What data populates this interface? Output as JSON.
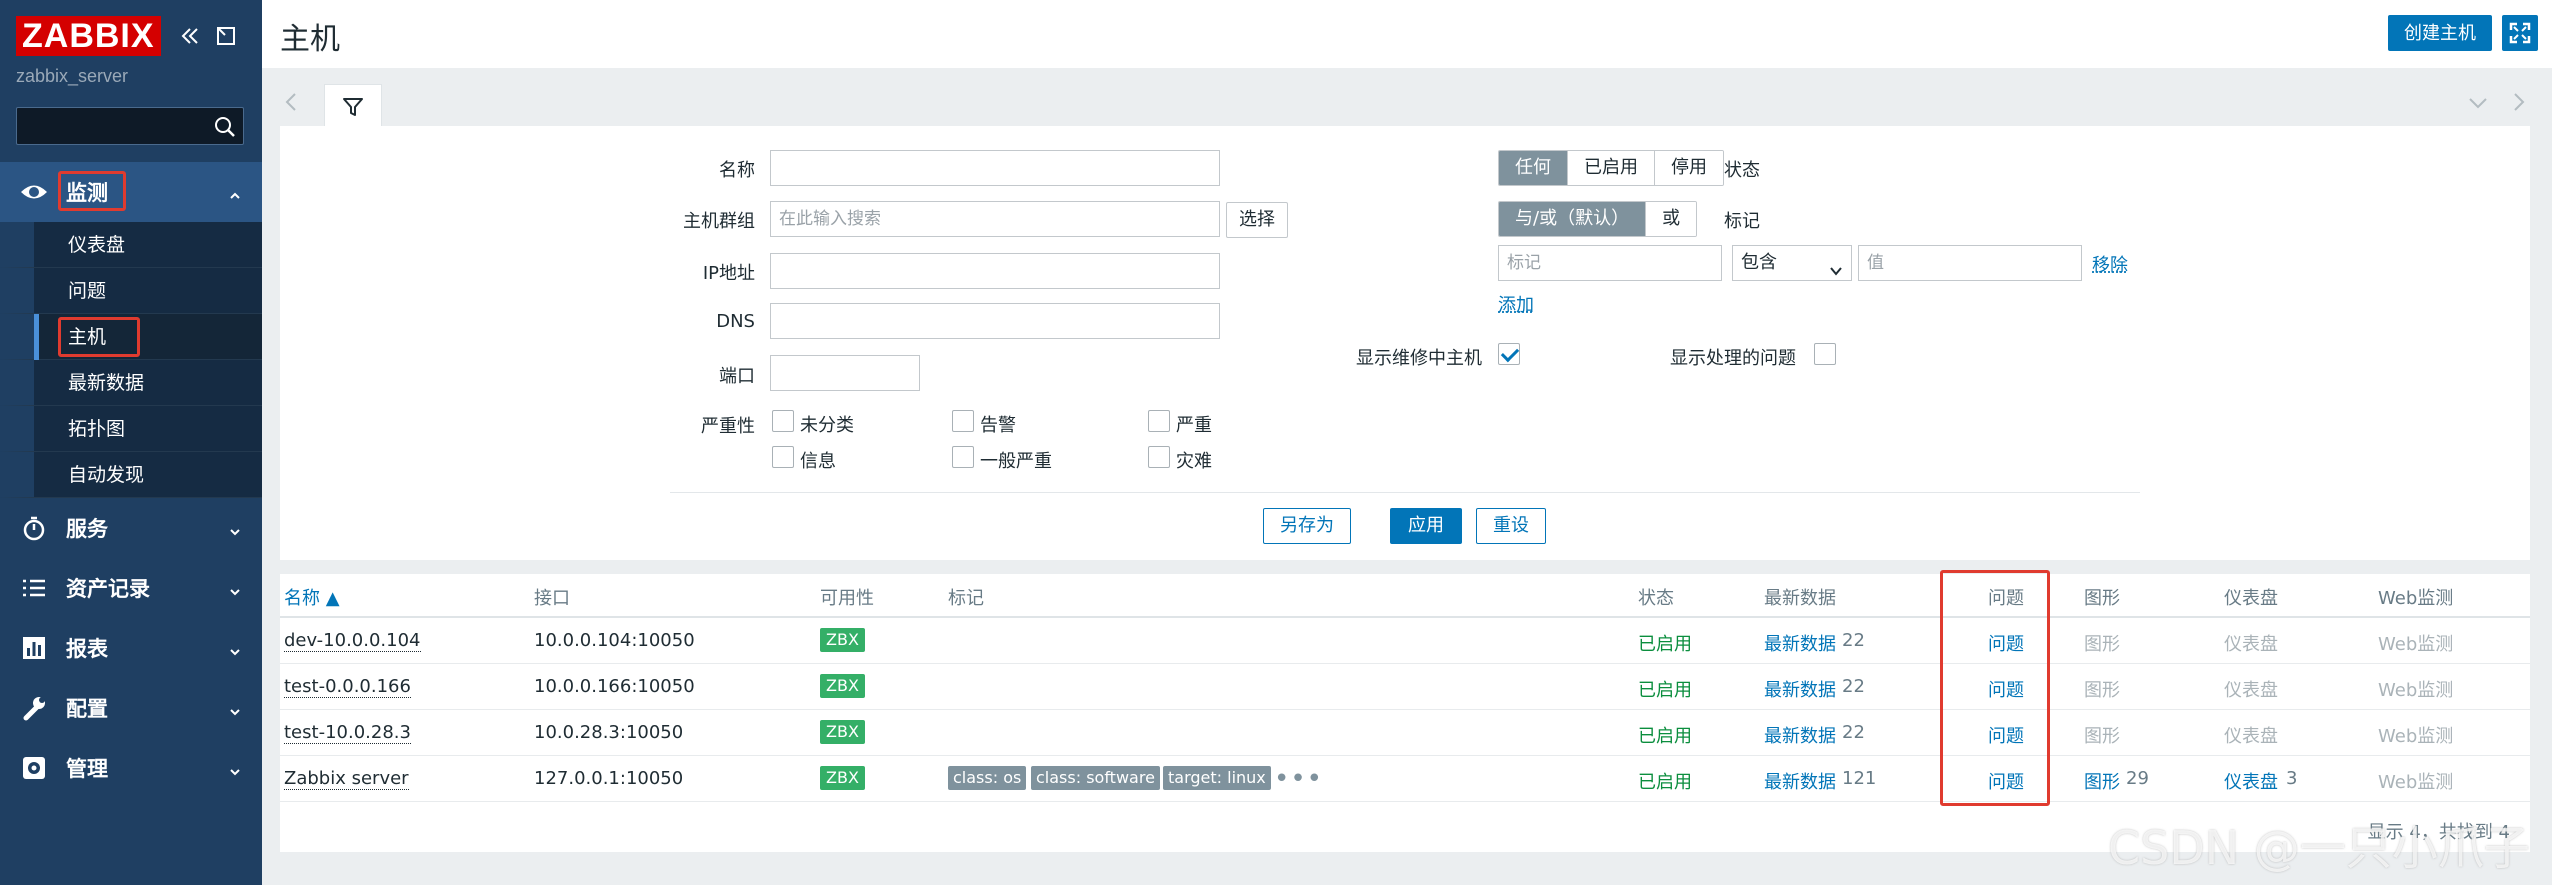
{
  "app": {
    "logo_text": "ZABBIX",
    "server_name": "zabbix_server",
    "search_value": ""
  },
  "menu": {
    "monitoring": {
      "label": "监测",
      "items": [
        "仪表盘",
        "问题",
        "主机",
        "最新数据",
        "拓扑图",
        "自动发现"
      ],
      "selected": "主机"
    },
    "sections": [
      {
        "label": "服务",
        "icon": "stopwatch-icon"
      },
      {
        "label": "资产记录",
        "icon": "list-icon"
      },
      {
        "label": "报表",
        "icon": "bar-chart-icon"
      },
      {
        "label": "配置",
        "icon": "wrench-icon"
      },
      {
        "label": "管理",
        "icon": "gear-icon"
      }
    ]
  },
  "header": {
    "title": "主机",
    "create_button": "创建主机"
  },
  "filter": {
    "name_label": "名称",
    "hostgroup_label": "主机群组",
    "hostgroup_placeholder": "在此输入搜索",
    "select_button": "选择",
    "ip_label": "IP地址",
    "dns_label": "DNS",
    "port_label": "端口",
    "severity_label": "严重性",
    "severities": [
      "未分类",
      "告警",
      "严重",
      "信息",
      "一般严重",
      "灾难"
    ],
    "status_label": "状态",
    "status_options": [
      "任何",
      "已启用",
      "停用"
    ],
    "status_selected": "任何",
    "tags_label": "标记",
    "tag_mode_options": [
      "与/或（默认）",
      "或"
    ],
    "tag_placeholder": "标记",
    "tag_operator": "包含",
    "tag_value_placeholder": "值",
    "remove_link": "移除",
    "add_link": "添加",
    "show_maintenance_label": "显示维修中主机",
    "show_maintenance_checked": true,
    "show_suppressed_label": "显示处理的问题",
    "show_suppressed_checked": false,
    "save_as_button": "另存为",
    "apply_button": "应用",
    "reset_button": "重设"
  },
  "table": {
    "columns": [
      "名称 ▲",
      "接口",
      "可用性",
      "标记",
      "状态",
      "最新数据",
      "问题",
      "图形",
      "仪表盘",
      "Web监测"
    ],
    "rows": [
      {
        "name": "dev-10.0.0.104",
        "interface": "10.0.0.104:10050",
        "availability": "ZBX",
        "tags": [],
        "status": "已启用",
        "latest": "最新数据",
        "latest_count": "22",
        "problems": "问题",
        "graphs": "图形",
        "graphs_count": "",
        "dashboards": "仪表盘",
        "dashboards_count": "",
        "web": "Web监测"
      },
      {
        "name": "test-0.0.0.166",
        "interface": "10.0.0.166:10050",
        "availability": "ZBX",
        "tags": [],
        "status": "已启用",
        "latest": "最新数据",
        "latest_count": "22",
        "problems": "问题",
        "graphs": "图形",
        "graphs_count": "",
        "dashboards": "仪表盘",
        "dashboards_count": "",
        "web": "Web监测"
      },
      {
        "name": "test-10.0.28.3",
        "interface": "10.0.28.3:10050",
        "availability": "ZBX",
        "tags": [],
        "status": "已启用",
        "latest": "最新数据",
        "latest_count": "22",
        "problems": "问题",
        "graphs": "图形",
        "graphs_count": "",
        "dashboards": "仪表盘",
        "dashboards_count": "",
        "web": "Web监测"
      },
      {
        "name": "Zabbix server",
        "interface": "127.0.0.1:10050",
        "availability": "ZBX",
        "tags": [
          "class: os",
          "class: software",
          "target: linux"
        ],
        "status": "已启用",
        "latest": "最新数据",
        "latest_count": "121",
        "problems": "问题",
        "graphs": "图形",
        "graphs_count": "29",
        "dashboards": "仪表盘",
        "dashboards_count": "3",
        "web": "Web监测"
      }
    ],
    "footer": "显示 4，共找到 4"
  },
  "watermark": "CSDN @一只小爪子",
  "colors": {
    "sidebar": "#1f3f62",
    "accent": "#0275b8",
    "enabled": "#0b8e3e",
    "zbx": "#34af67",
    "highlight_box": "#e03b2f"
  }
}
